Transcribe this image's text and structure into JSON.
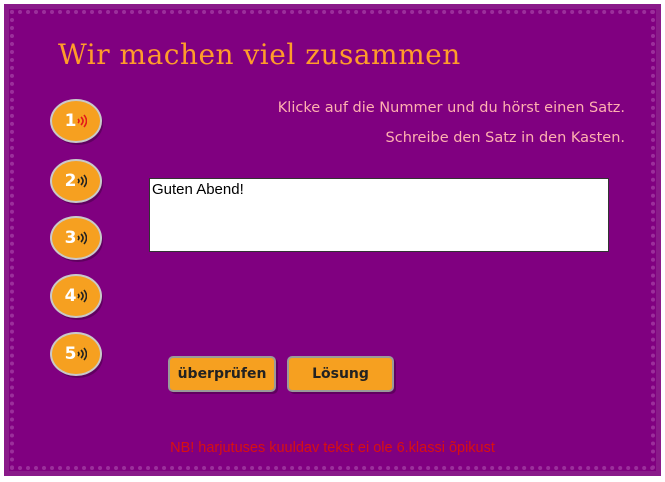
{
  "title": "Wir machen viel zusammen",
  "instructions": {
    "line1": "Klicke auf die Nummer und du hörst einen Satz.",
    "line2": "Schreibe den Satz in den Kasten."
  },
  "number_buttons": [
    {
      "label": "1",
      "icon": "speaker-icon",
      "active": true
    },
    {
      "label": "2",
      "icon": "speaker-icon",
      "active": false
    },
    {
      "label": "3",
      "icon": "speaker-icon",
      "active": false
    },
    {
      "label": "4",
      "icon": "speaker-icon",
      "active": false
    },
    {
      "label": "5",
      "icon": "speaker-icon",
      "active": false
    }
  ],
  "answer_box": {
    "value": "Guten Abend!"
  },
  "buttons": {
    "check_label": "überprüfen",
    "solution_label": "Lösung"
  },
  "footer_note": "NB! harjutuses kuuldav tekst ei ole 6.klassi õpikust",
  "colors": {
    "background": "#800080",
    "accent": "#f6a020",
    "title": "#ff9c2a",
    "instructions": "#ffb0b0",
    "note": "#d81010",
    "speaker_active": "#e21a1a"
  }
}
